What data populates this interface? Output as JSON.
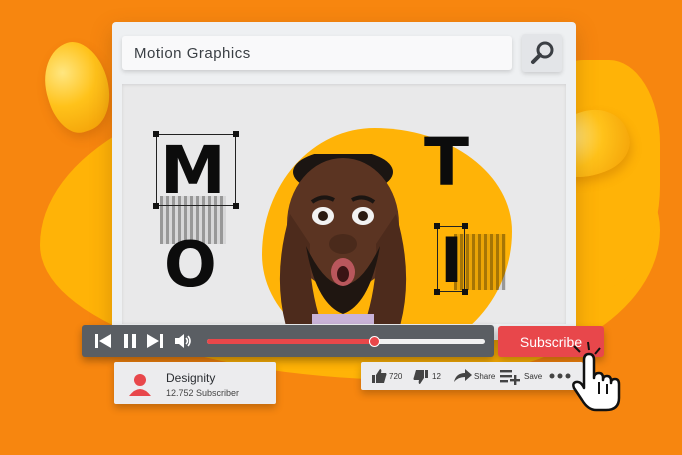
{
  "search": {
    "value": "Motion Graphics"
  },
  "video": {
    "letters": {
      "m": "M",
      "o": "O",
      "t": "T",
      "i": "I"
    }
  },
  "player": {
    "progress": 0.6
  },
  "subscribe": {
    "label": "Subscribe"
  },
  "channel": {
    "name": "Designity",
    "subscribers": "12.752 Subscriber"
  },
  "actions": {
    "likes": "720",
    "dislikes": "12",
    "share": "Share",
    "save": "Save"
  },
  "colors": {
    "background": "#f7860f",
    "accent": "#e8474b",
    "blob": "#ffb307"
  },
  "icons": [
    "search-icon",
    "skip-back-icon",
    "pause-icon",
    "skip-forward-icon",
    "volume-icon",
    "user-icon",
    "thumbs-up-icon",
    "thumbs-down-icon",
    "share-arrow-icon",
    "playlist-add-icon",
    "more-icon",
    "hand-cursor-icon"
  ]
}
